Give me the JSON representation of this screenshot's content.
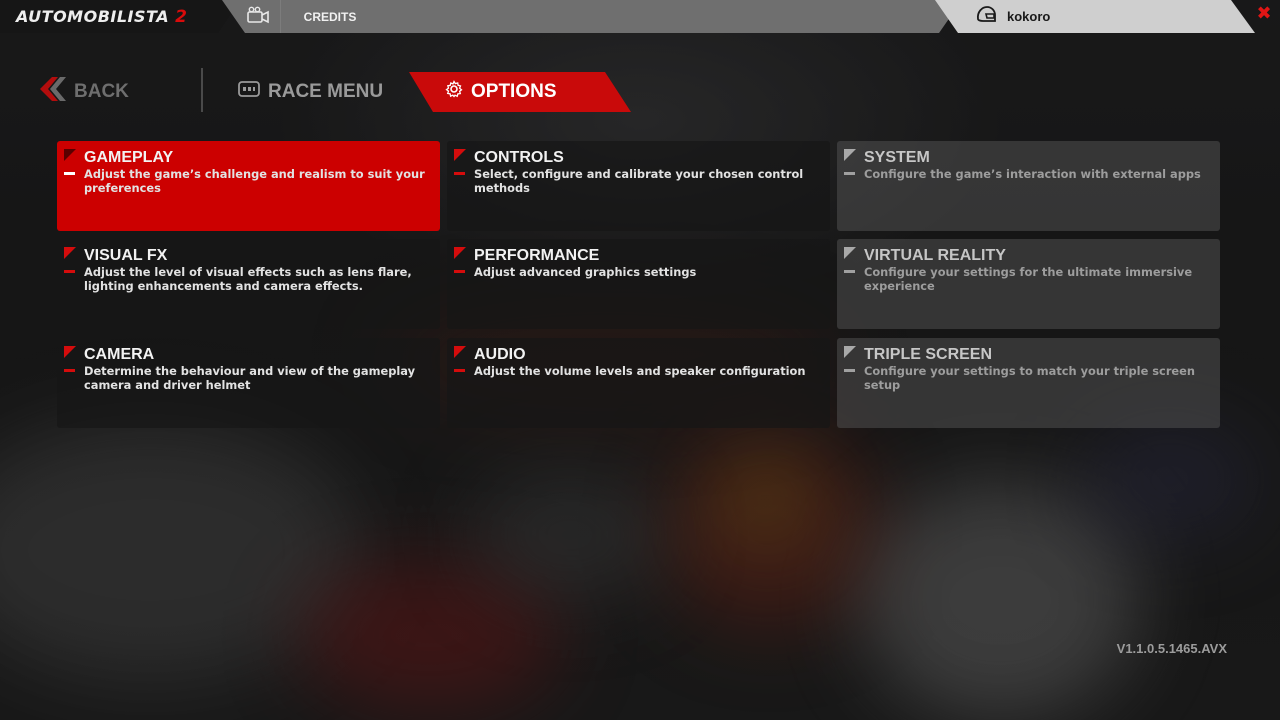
{
  "topbar": {
    "logo_text": "AUTOMOBILISTA",
    "logo_number": "2",
    "credits_label": "CREDITS",
    "username": "kokoro",
    "replay_icon": "camera-icon",
    "profile_icon": "helmet-icon",
    "close_icon": "close-icon"
  },
  "nav": {
    "back_label": "BACK",
    "race_menu_label": "RACE MENU",
    "options_label": "OPTIONS",
    "options_icon": "gear-icon"
  },
  "tiles": [
    {
      "title": "GAMEPLAY",
      "desc": "Adjust the game’s challenge and realism to suit your preferences",
      "state": "active"
    },
    {
      "title": "CONTROLS",
      "desc": "Select, configure and calibrate your chosen control methods",
      "state": "normal"
    },
    {
      "title": "SYSTEM",
      "desc": "Configure the game’s interaction with external apps",
      "state": "disabled"
    },
    {
      "title": "VISUAL FX",
      "desc": "Adjust the level of visual effects such as lens flare, lighting enhancements and camera effects.",
      "state": "normal"
    },
    {
      "title": "PERFORMANCE",
      "desc": "Adjust advanced graphics settings",
      "state": "normal"
    },
    {
      "title": "VIRTUAL REALITY",
      "desc": "Configure your settings for the ultimate immersive experience",
      "state": "disabled"
    },
    {
      "title": "CAMERA",
      "desc": "Determine the behaviour and view of the gameplay camera and driver helmet",
      "state": "normal"
    },
    {
      "title": "AUDIO",
      "desc": "Adjust the volume levels and speaker configuration",
      "state": "normal"
    },
    {
      "title": "TRIPLE SCREEN",
      "desc": "Configure your settings to match your triple screen setup",
      "state": "disabled"
    }
  ],
  "version": "V1.1.0.5.1465.AVX",
  "colors": {
    "accent": "#cc0000",
    "topbar_mid": "#6f6f6f",
    "topbar_right": "#cfcfcf"
  }
}
